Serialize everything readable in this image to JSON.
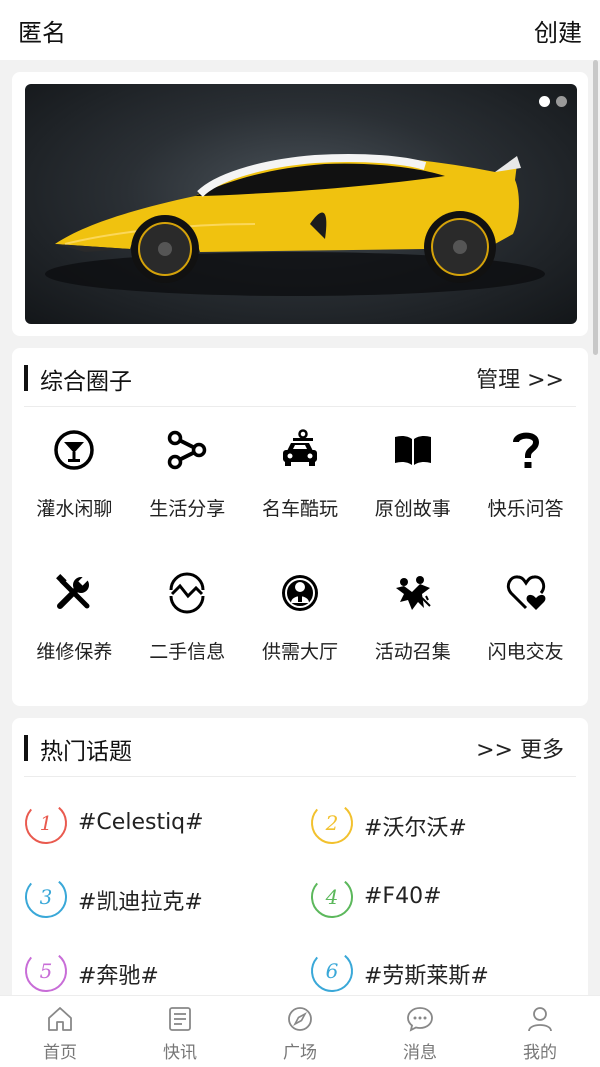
{
  "topbar": {
    "left_label": "匿名",
    "right_label": "创建"
  },
  "banner": {
    "slide_count": 2,
    "active_slide": 1
  },
  "circles": {
    "title": "综合圈子",
    "manage_label": "管理 >>",
    "items": [
      {
        "label": "灌水闲聊",
        "icon": "cocktail-icon"
      },
      {
        "label": "生活分享",
        "icon": "share-icon"
      },
      {
        "label": "名车酷玩",
        "icon": "car-icon"
      },
      {
        "label": "原创故事",
        "icon": "book-icon"
      },
      {
        "label": "快乐问答",
        "icon": "question-icon"
      },
      {
        "label": "维修保养",
        "icon": "tools-icon"
      },
      {
        "label": "二手信息",
        "icon": "exchange-icon"
      },
      {
        "label": "供需大厅",
        "icon": "person-badge-icon"
      },
      {
        "label": "活动召集",
        "icon": "people-party-icon"
      },
      {
        "label": "闪电交友",
        "icon": "heart-icon"
      }
    ]
  },
  "topics": {
    "title": "热门话题",
    "more_label": ">> 更多",
    "items": [
      {
        "rank": "1",
        "name": "#Celestiq#",
        "color": "#e95a4f"
      },
      {
        "rank": "2",
        "name": "#沃尔沃#",
        "color": "#f2c12e"
      },
      {
        "rank": "3",
        "name": "#凯迪拉克#",
        "color": "#3aa8d8"
      },
      {
        "rank": "4",
        "name": "#F40#",
        "color": "#5cb85c"
      },
      {
        "rank": "5",
        "name": "#奔驰#",
        "color": "#c86dd7"
      },
      {
        "rank": "6",
        "name": "#劳斯莱斯#",
        "color": "#3aa8d8"
      }
    ]
  },
  "tabbar": {
    "items": [
      {
        "label": "首页",
        "icon": "home-icon"
      },
      {
        "label": "快讯",
        "icon": "news-icon"
      },
      {
        "label": "广场",
        "icon": "compass-icon"
      },
      {
        "label": "消息",
        "icon": "message-icon"
      },
      {
        "label": "我的",
        "icon": "user-icon"
      }
    ]
  }
}
